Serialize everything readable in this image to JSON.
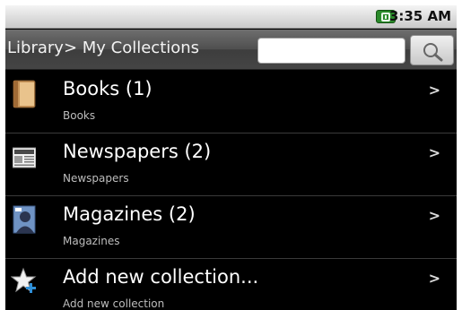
{
  "status_bar": {
    "time": "3:35 AM"
  },
  "header": {
    "title": "Library> My Collections",
    "search_placeholder": ""
  },
  "collections": [
    {
      "label": "Books (1)",
      "sublabel": "Books",
      "chevron": ">",
      "icon": "book-icon"
    },
    {
      "label": "Newspapers (2)",
      "sublabel": "Newspapers",
      "chevron": ">",
      "icon": "newspaper-icon"
    },
    {
      "label": "Magazines (2)",
      "sublabel": "Magazines",
      "chevron": ">",
      "icon": "magazine-icon"
    },
    {
      "label": "Add new collection...",
      "sublabel": "Add new collection",
      "chevron": ">",
      "icon": "star-add-icon"
    }
  ]
}
